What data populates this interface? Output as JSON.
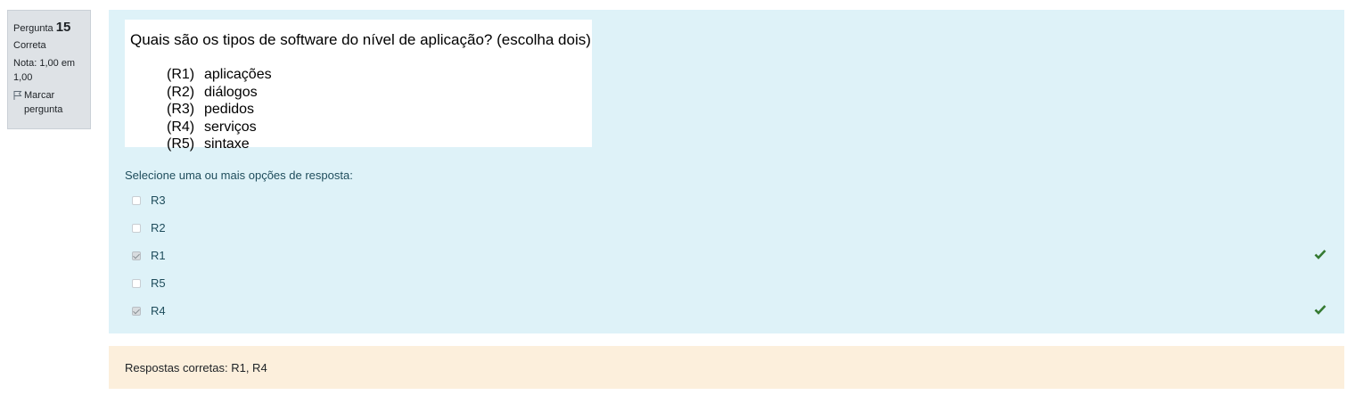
{
  "info": {
    "question_label": "Pergunta",
    "question_number": "15",
    "state": "Correta",
    "grade": "Nota: 1,00 em 1,00",
    "flag_label": "Marcar pergunta",
    "flag_icon": "flag-icon"
  },
  "question": {
    "text": "Quais são os tipos de software do nível de aplicação? (escolha dois)",
    "options": [
      {
        "code": "(R1)",
        "label": "aplicações"
      },
      {
        "code": "(R2)",
        "label": "diálogos"
      },
      {
        "code": "(R3)",
        "label": "pedidos"
      },
      {
        "code": "(R4)",
        "label": "serviços"
      },
      {
        "code": "(R5)",
        "label": "sintaxe"
      }
    ]
  },
  "prompt": "Selecione uma ou mais opções de resposta:",
  "answers": [
    {
      "label": "R3",
      "checked": false,
      "correct": false
    },
    {
      "label": "R2",
      "checked": false,
      "correct": false
    },
    {
      "label": "R1",
      "checked": true,
      "correct": true
    },
    {
      "label": "R5",
      "checked": false,
      "correct": false
    },
    {
      "label": "R4",
      "checked": true,
      "correct": true
    }
  ],
  "feedback": "Respostas corretas: R1, R4",
  "colors": {
    "content_bg": "#def2f8",
    "feedback_bg": "#fcefdc",
    "info_bg": "#dee2e6",
    "tick": "#357a32"
  }
}
